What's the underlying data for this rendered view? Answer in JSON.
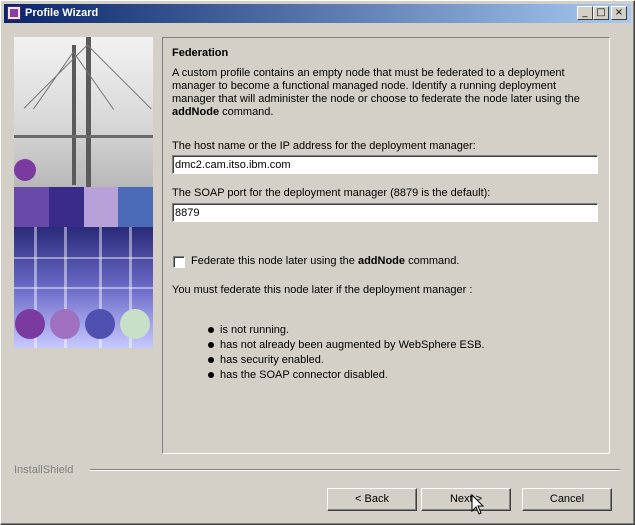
{
  "window": {
    "title": "Profile Wizard"
  },
  "titlebar_buttons": {
    "minimize": "_",
    "maximize": "□",
    "close": "×"
  },
  "content": {
    "heading": "Federation",
    "description": "A custom profile contains an empty node that must be federated to a deployment manager to become a functional managed node. Identify a running deployment manager that will administer the node or choose to federate the node later using the ",
    "description_command": "addNode",
    "description_tail": " command.",
    "host_label": "The host name or the IP address for the deployment manager:",
    "host_value": "dmc2.cam.itso.ibm.com",
    "soap_label": "The SOAP port for the deployment manager (8879 is the default):",
    "soap_value": "8879",
    "federate_later": {
      "checked": false,
      "label_prefix": "Federate this node later using the ",
      "label_command": "addNode",
      "label_suffix": " command."
    },
    "note": "You must federate this node later if the deployment manager :",
    "conditions": [
      "is not running.",
      "has not already been augmented by WebSphere ESB.",
      "has security enabled.",
      "has the SOAP connector disabled."
    ]
  },
  "footer": {
    "brand": "InstallShield",
    "back_label": "< Back",
    "next_label": "Next >",
    "cancel_label": "Cancel"
  },
  "colors": {
    "title_start": "#0a246a",
    "title_end": "#a6caf0",
    "face": "#d4d0c8"
  }
}
